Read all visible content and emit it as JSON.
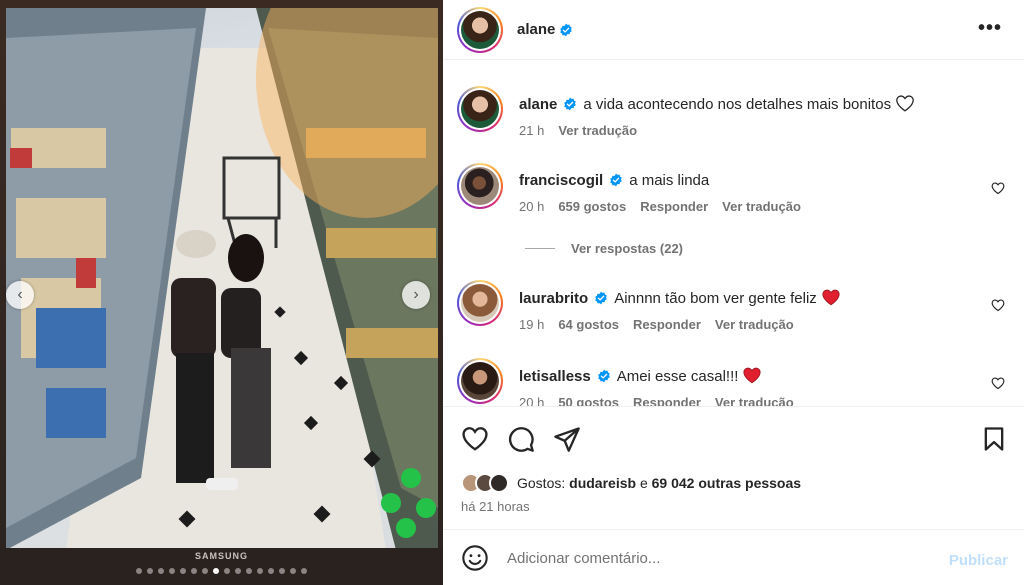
{
  "brand_text": "SAMSUNG",
  "carousel": {
    "dot_count": 16,
    "active_index": 7
  },
  "post": {
    "username": "alane",
    "verified": true
  },
  "caption": {
    "username": "alane",
    "text": "a vida acontecendo nos detalhes mais bonitos",
    "time": "21 h",
    "translate": "Ver tradução"
  },
  "comments": [
    {
      "username": "franciscogil",
      "text": "a mais linda",
      "time": "20 h",
      "likes": "659 gostos",
      "reply": "Responder",
      "translate": "Ver tradução",
      "view_replies": "Ver respostas (22)"
    },
    {
      "username": "laurabrito",
      "text": "Ainnnn tão bom ver gente feliz",
      "time": "19 h",
      "likes": "64 gostos",
      "reply": "Responder",
      "translate": "Ver tradução"
    },
    {
      "username": "letisalless",
      "text": "Amei esse casal!!!",
      "time": "20 h",
      "likes": "50 gostos",
      "reply": "Responder",
      "translate": "Ver tradução"
    }
  ],
  "likes": {
    "prefix": "Gostos:",
    "first_user": "dudareisb",
    "connector": "e",
    "others": "69 042 outras pessoas"
  },
  "posted_ago": "há 21 horas",
  "comment_box": {
    "placeholder": "Adicionar comentário...",
    "publish_label": "Publicar"
  },
  "colors": {
    "verified": "#0095f6",
    "heart_red": "#ed4956",
    "publish_disabled": "#c0dffd",
    "meta_gray": "#737373"
  }
}
